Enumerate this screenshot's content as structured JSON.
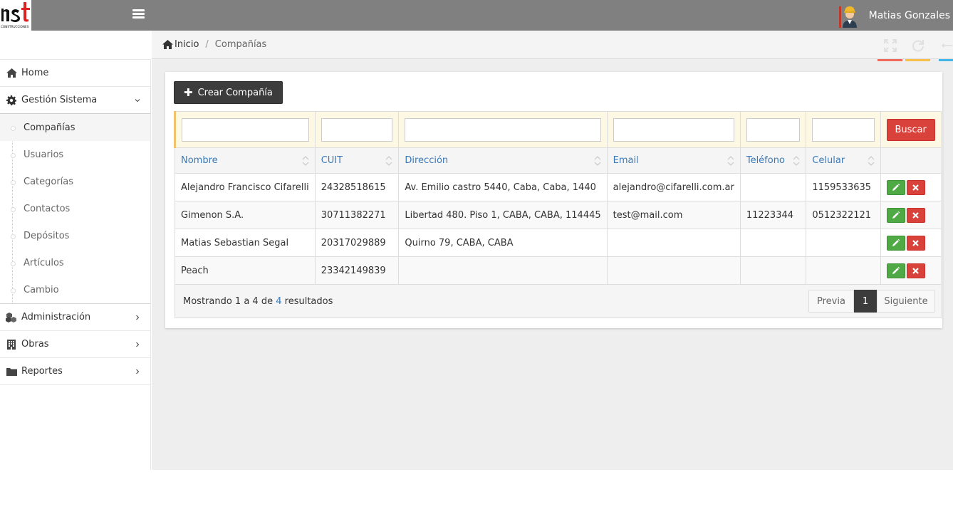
{
  "user": {
    "name": "Matias Gonzales"
  },
  "breadcrumb": {
    "home": "Inicio",
    "current": "Compañías"
  },
  "sidebar": {
    "items": [
      {
        "label": "Home",
        "icon": "home-icon"
      },
      {
        "label": "Gestión Sistema",
        "icon": "gear-icon"
      },
      {
        "label": "Administración",
        "icon": "cubes-icon"
      },
      {
        "label": "Obras",
        "icon": "building-icon"
      },
      {
        "label": "Reportes",
        "icon": "folder-icon"
      }
    ],
    "subitems": [
      "Compañías",
      "Usuarios",
      "Categorías",
      "Contactos",
      "Depósitos",
      "Artículos",
      "Cambio"
    ]
  },
  "toolbar": {
    "create_label": "Crear Compañía",
    "search_label": "Buscar"
  },
  "table": {
    "headers": [
      "Nombre",
      "CUIT",
      "Dirección",
      "Email",
      "Teléfono",
      "Celular"
    ],
    "rows": [
      [
        "Alejandro Francisco Cifarelli",
        "24328518615",
        "Av. Emilio castro 5440, Caba, Caba, 1440",
        "alejandro@cifarelli.com.ar",
        "",
        "1159533635"
      ],
      [
        "Gimenon S.A.",
        "30711382271",
        "Libertad 480. Piso 1, CABA, CABA, 114445",
        "test@mail.com",
        "11223344",
        "0512322121"
      ],
      [
        "Matias Sebastian Segal",
        "20317029889",
        "Quirno 79, CABA, CABA",
        "",
        "",
        ""
      ],
      [
        "Peach",
        "23342149839",
        "",
        "",
        "",
        ""
      ]
    ]
  },
  "footer": {
    "showing_prefix": "Mostrando 1 a 4 de ",
    "showing_total": "4",
    "showing_suffix": " resultados",
    "prev": "Previa",
    "page": "1",
    "next": "Siguiente"
  },
  "colors": {
    "accent_red": "#d9413b",
    "accent_green": "#4fa945",
    "link_blue": "#3a7ab8",
    "topbar": "#808080"
  }
}
